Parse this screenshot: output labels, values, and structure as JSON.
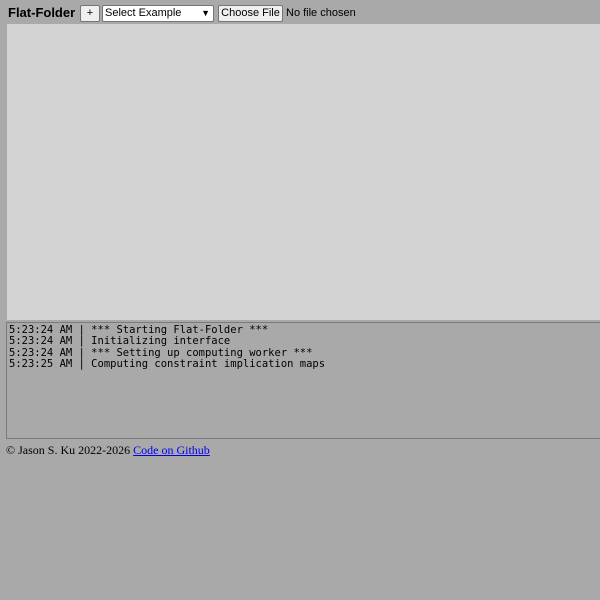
{
  "header": {
    "app_title": "Flat-Folder",
    "plus_label": "+",
    "example_select": {
      "selected": "Select Example",
      "icon": "chevron-down-icon"
    },
    "choose_file_label": "Choose File",
    "file_status": "No file chosen"
  },
  "log": {
    "lines": [
      "5:23:24 AM | *** Starting Flat-Folder ***",
      "5:23:24 AM | Initializing interface",
      "5:23:24 AM | *** Setting up computing worker ***",
      "5:23:25 AM | Computing constraint implication maps"
    ]
  },
  "footer": {
    "copyright": "© Jason S. Ku 2022-2026",
    "github_link": "Code on Github"
  },
  "colors": {
    "page_background": "#a9a9a9",
    "canvas_background": "#d3d3d3",
    "link": "#0000ee"
  }
}
